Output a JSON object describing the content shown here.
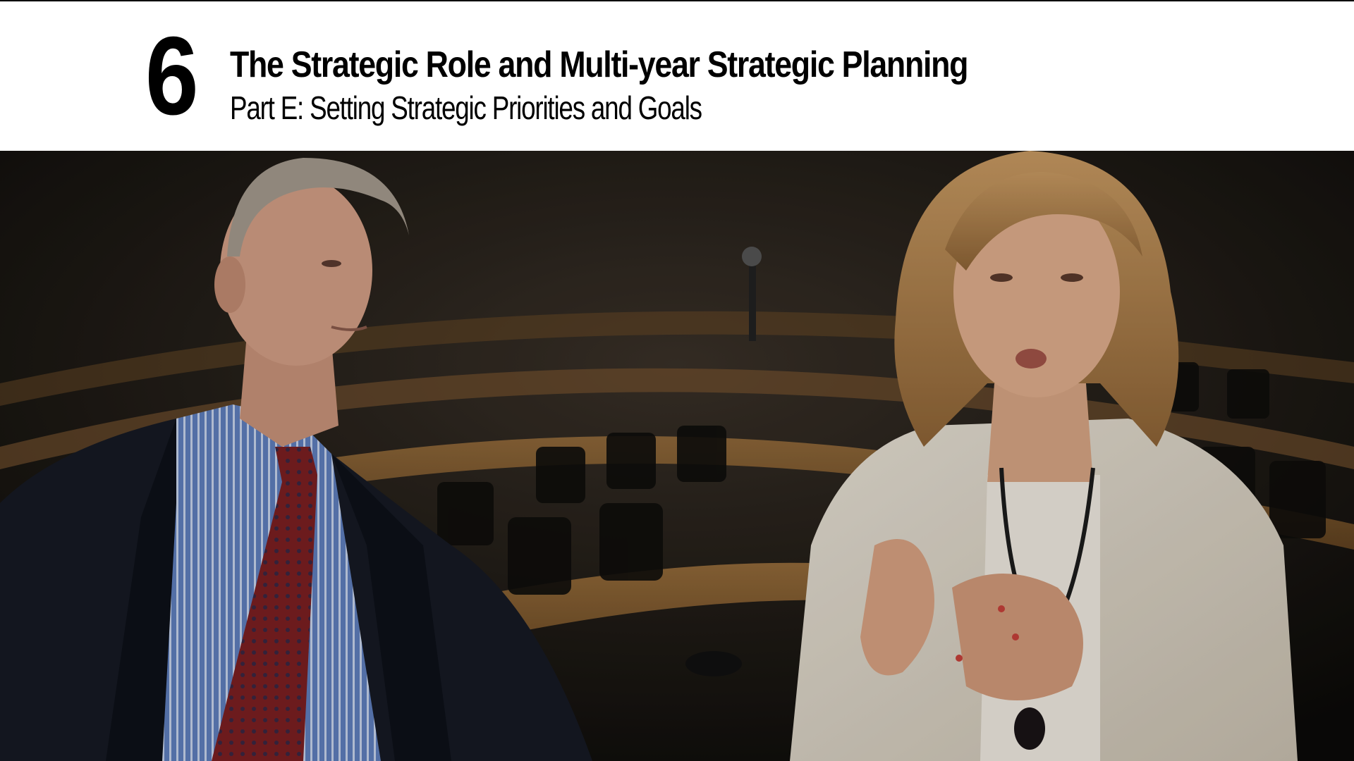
{
  "title_card": {
    "chapter_number": "6",
    "title": "The Strategic Role and Multi-year Strategic Planning",
    "subtitle": "Part E: Setting Strategic Priorities and Goals"
  },
  "scene": {
    "setting": "dim legislative chamber with curved wooden desks and black chairs",
    "people": [
      "man-in-suit",
      "woman-in-white-jacket"
    ]
  }
}
